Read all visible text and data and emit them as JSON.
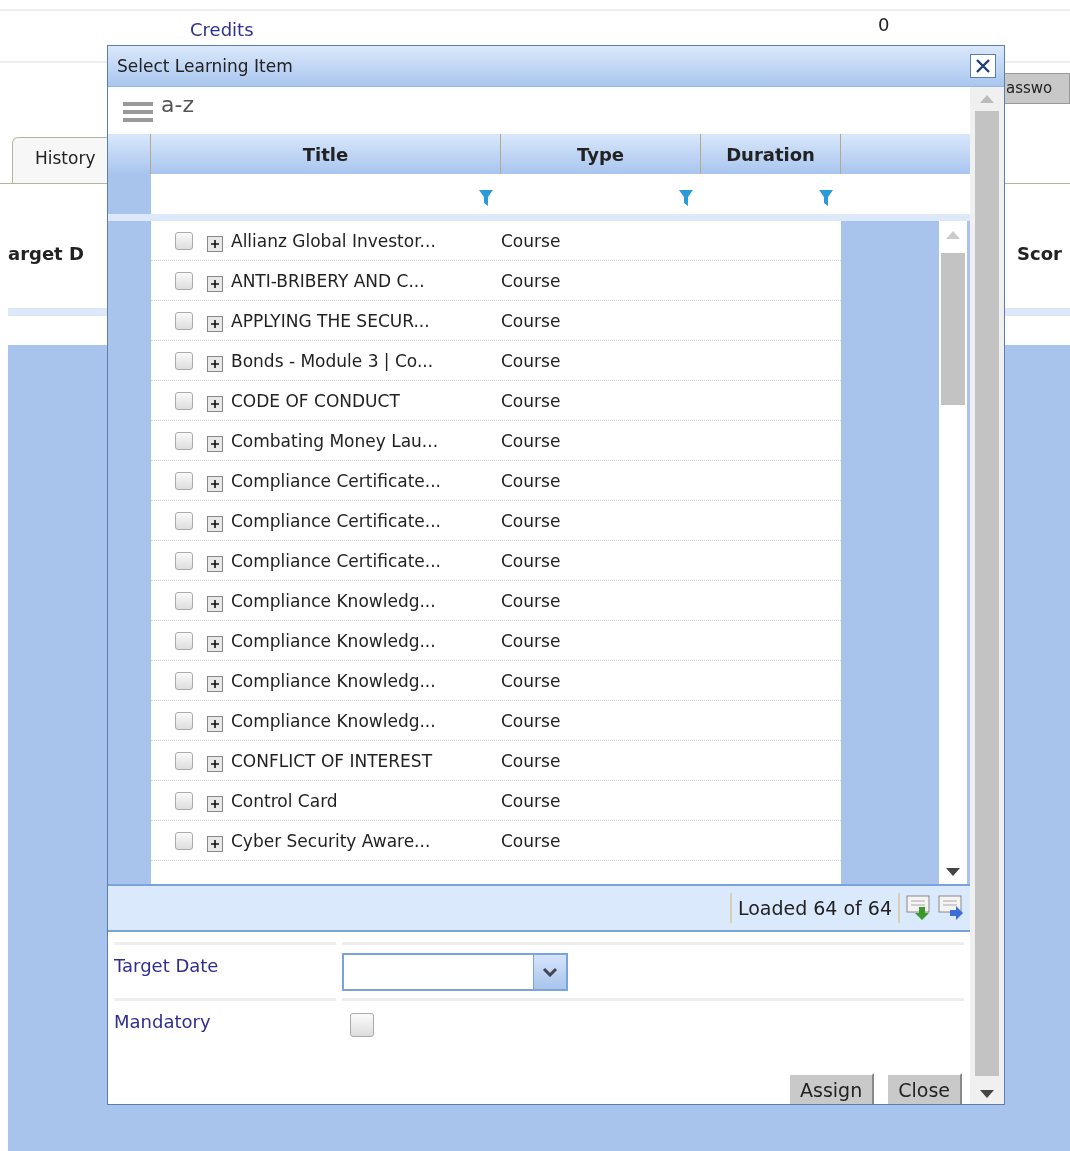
{
  "page": {
    "credits_label": "Credits",
    "credits_value": "0",
    "partial_button": "asswo",
    "tabs": [
      {
        "label": "History",
        "selected": true
      }
    ],
    "columns": [
      "arget D",
      "Scor"
    ]
  },
  "dialog": {
    "title": "Select Learning Item",
    "sort_label": "a-z",
    "columns": [
      "Title",
      "Type",
      "Duration"
    ],
    "rows": [
      {
        "title": "Allianz Global Investor...",
        "type": "Course",
        "checked": false
      },
      {
        "title": "ANTI-BRIBERY AND C...",
        "type": "Course",
        "checked": false
      },
      {
        "title": "APPLYING THE SECUR...",
        "type": "Course",
        "checked": false
      },
      {
        "title": "Bonds - Module 3 | Co...",
        "type": "Course",
        "checked": false
      },
      {
        "title": "CODE OF CONDUCT",
        "type": "Course",
        "checked": false
      },
      {
        "title": "Combating Money Lau...",
        "type": "Course",
        "checked": false
      },
      {
        "title": "Compliance Certificate...",
        "type": "Course",
        "checked": false
      },
      {
        "title": "Compliance Certificate...",
        "type": "Course",
        "checked": false
      },
      {
        "title": "Compliance Certificate...",
        "type": "Course",
        "checked": false
      },
      {
        "title": "Compliance Knowledg...",
        "type": "Course",
        "checked": false
      },
      {
        "title": "Compliance Knowledg...",
        "type": "Course",
        "checked": false
      },
      {
        "title": "Compliance Knowledg...",
        "type": "Course",
        "checked": false
      },
      {
        "title": "Compliance Knowledg...",
        "type": "Course",
        "checked": false
      },
      {
        "title": "CONFLICT OF INTEREST",
        "type": "Course",
        "checked": false
      },
      {
        "title": "Control Card",
        "type": "Course",
        "checked": false
      },
      {
        "title": "Cyber Security Aware...",
        "type": "Course",
        "checked": false
      }
    ],
    "paging": "Loaded 64 of 64",
    "target_date": {
      "label": "Target Date"
    },
    "mandatory": {
      "label": "Mandatory",
      "checked": false
    },
    "buttons": [
      "Assign",
      "Close"
    ]
  }
}
